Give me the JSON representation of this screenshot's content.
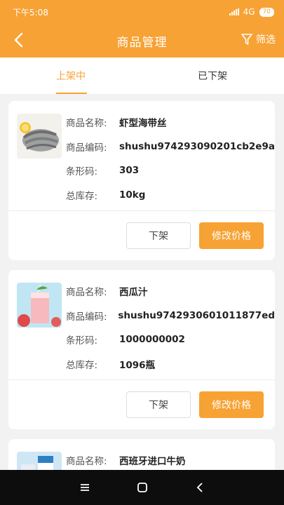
{
  "status": {
    "time": "下午5:08",
    "network": "4G",
    "battery": "70"
  },
  "nav": {
    "title": "商品管理",
    "filter_label": "筛选"
  },
  "tabs": [
    {
      "label": "上架中",
      "active": true
    },
    {
      "label": "已下架",
      "active": false
    }
  ],
  "labels": {
    "name": "商品名称:",
    "code": "商品编码:",
    "barcode": "条形码:",
    "stock": "总库存:"
  },
  "products": [
    {
      "name": "虾型海带丝",
      "code": "shushu974293090201cb2e9a",
      "barcode": "303",
      "stock": "10kg",
      "thumb": "shrimp-image",
      "off_label": "下架",
      "price_label": "修改价格"
    },
    {
      "name": "西瓜汁",
      "code": "shushu9742930601011877ed",
      "barcode": "1000000002",
      "stock": "1096瓶",
      "thumb": "juice-image",
      "off_label": "下架",
      "price_label": "修改价格"
    },
    {
      "name": "西班牙进口牛奶",
      "thumb": "milk-image"
    }
  ],
  "colors": {
    "accent": "#f7a234"
  }
}
